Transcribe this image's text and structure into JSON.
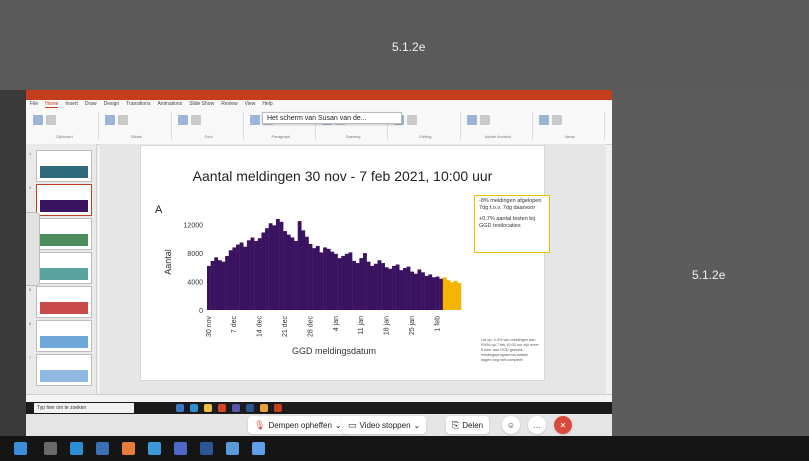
{
  "redaction": {
    "label_top": "5.1.2e",
    "label_right": "5.1.2e"
  },
  "share_popover": {
    "text": "Het scherm van Susan van de..."
  },
  "ribbon": {
    "tabs": [
      "File",
      "Home",
      "Insert",
      "Draw",
      "Design",
      "Transitions",
      "Animations",
      "Slide Show",
      "Review",
      "View",
      "Help"
    ],
    "active_tab": "Home",
    "groups": [
      "Clipboard",
      "Slides",
      "Font",
      "Paragraph",
      "Drawing",
      "Editing",
      "Adobe Acrobat",
      "Ideas"
    ]
  },
  "slide": {
    "title": "Aantal meldingen 30 nov - 7 feb 2021, 10:00 uur",
    "panel_letter": "A",
    "info_box": {
      "line1": "-8% meldingen afgelopen 7dg t.o.v. 7dg daarvoor",
      "line2": "+0.7% aantal testen bij GGD testlocaties"
    },
    "note": "Let op: 4,4% van meldingen aan RIVM op 7 feb 10:00 uur zijn meer 5 keer aan GGD gemeld; meldingsprogramma laatste dagen nog niet compleet"
  },
  "chart_data": {
    "type": "bar",
    "title": "Aantal meldingen 30 nov - 7 feb 2021, 10:00 uur",
    "xlabel": "GGD meldingsdatum",
    "ylabel": "Aantal",
    "ylim": [
      0,
      13500
    ],
    "yticks": [
      0,
      4000,
      8000,
      12000
    ],
    "xticks": [
      "30 nov",
      "7 dec",
      "14 dec",
      "21 dec",
      "28 dec",
      "4 jan",
      "11 jan",
      "18 jan",
      "25 jan",
      "1 feb"
    ],
    "colors": {
      "complete": "#3b1260",
      "incomplete": "#f5b400"
    },
    "series": [
      {
        "name": "",
        "values": [
          6200,
          6900,
          7400,
          7000,
          6800,
          7600,
          8400,
          8800,
          9200,
          9500,
          8900,
          9800,
          10200,
          9700,
          10100,
          10900,
          11500,
          12200,
          11900,
          12800,
          12400,
          11100,
          10600,
          10200,
          9700,
          12500,
          11200,
          10300,
          9300,
          8700,
          9000,
          8100,
          8800,
          8600,
          8200,
          7900,
          7300,
          7600,
          7900,
          8100,
          6900,
          6600,
          7300,
          8000,
          6800,
          6200,
          6500,
          7000,
          6600,
          6000,
          5800,
          6200,
          6400,
          5600,
          5900,
          6100,
          5400,
          5100,
          5700,
          5300,
          4800,
          5000,
          4600,
          4700,
          4400,
          4600,
          4200,
          3900,
          4100,
          3800
        ]
      }
    ],
    "incomplete_from_index": 65
  },
  "teams": {
    "unmute": "Dempen opheffen",
    "video": "Video stoppen",
    "share": "Delen"
  },
  "taskbar": {
    "search_placeholder": "Typ hier om te zoeken"
  }
}
